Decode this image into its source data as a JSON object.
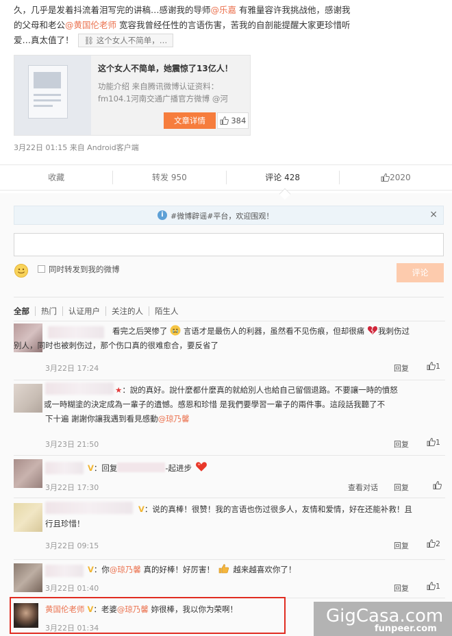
{
  "post": {
    "line1_a": "久，几乎是发着抖流着泪写完的讲稿…感谢我的导师",
    "line1_mention": "@乐嘉",
    "line1_b": " 有雅量容许我挑战他，感谢我",
    "line2_a": "的父母和老公",
    "line2_mention": "@黄国伦老师",
    "line2_b": " 宽容我曾经任性的言语伤害，苦我的自剖能提醒大家更珍惜听",
    "line3_a": "爱…真太值了！",
    "tag_chip": "这个女人不简单，…",
    "card_title": "这个女人不简单，她震惊了13亿人！",
    "card_desc": "功能介绍 来自腾讯微博认证资料：fm104.1河南交通广播官方微博 @河",
    "card_button": "文章详情",
    "card_likes": "384",
    "meta": "3月22日 01:15 来自 Android客户端"
  },
  "actions": {
    "collect": "收藏",
    "forward": "转发 950",
    "comment": "评论 428",
    "like": "2020"
  },
  "notice": {
    "text": "#微博辟谣#平台，欢迎围观！",
    "close": "×"
  },
  "composer": {
    "forward_label": "同时转发到我的微博",
    "submit": "评论"
  },
  "filters": [
    "全部",
    "热门",
    "认证用户",
    "关注的人",
    "陌生人"
  ],
  "comments": [
    {
      "text_a": "看完之后哭惨了",
      "text_b": "言语才是最伤人的利器，虽然看不见伤痕，但却很痛",
      "text_c": "我刺伤过",
      "line2": "别人，同时也被刺伤过，那个伤口真的很难愈合，要反省了",
      "time": "3月22日 17:24",
      "reply": "回复",
      "likes": "1"
    },
    {
      "badge": "★",
      "line1": "：說的真好。說什麼都什麼真的就給別人也給自己留個退路。不要讓一時的憤怒",
      "line2": "或一時糊塗的決定成為一輩子的遺憾。感恩和珍惜 是我們要學習一輩子的兩件事。這段話我聽了不",
      "line3_a": "下十遍 謝謝你讓我遇到看見感動",
      "line3_mention": "@琼乃馨",
      "time": "3月23日 21:50",
      "reply": "回复",
      "likes": "1"
    },
    {
      "badge": "V",
      "reply_word": "：回复",
      "text": "-起进步",
      "time": "3月22日 17:30",
      "view_conv": "查看对话",
      "reply": "回复",
      "likes": ""
    },
    {
      "badge": "V",
      "line1": "：说的真棒！很赞！我的言语也伤过很多人，友情和爱情，好在还能补救！且",
      "line2": "行且珍惜！",
      "time": "3月22日 09:15",
      "reply": "回复",
      "likes": "2"
    },
    {
      "badge": "V",
      "text_a": "：你",
      "mention": "@琼乃馨",
      "text_b": " 真的好棒！好厉害！",
      "text_c": "越来越喜欢你了！",
      "time": "3月22日 01:40",
      "reply": "回复",
      "likes": "1"
    },
    {
      "name": "黄国伦老师",
      "badge": "V",
      "text_a": "：老婆",
      "mention": "@琼乃馨",
      "text_b": " 妳很棒，我以你为荣啊！",
      "time": "3月22日 01:34"
    }
  ],
  "watermark": {
    "gigcasa": "GigCasa.com",
    "funpeer": "funpeer.com"
  },
  "colors": {
    "accent_orange": "#f67d3d",
    "mention": "#eb7350",
    "highlight_red": "#e02b20",
    "vip_gold": "#f1b533"
  }
}
